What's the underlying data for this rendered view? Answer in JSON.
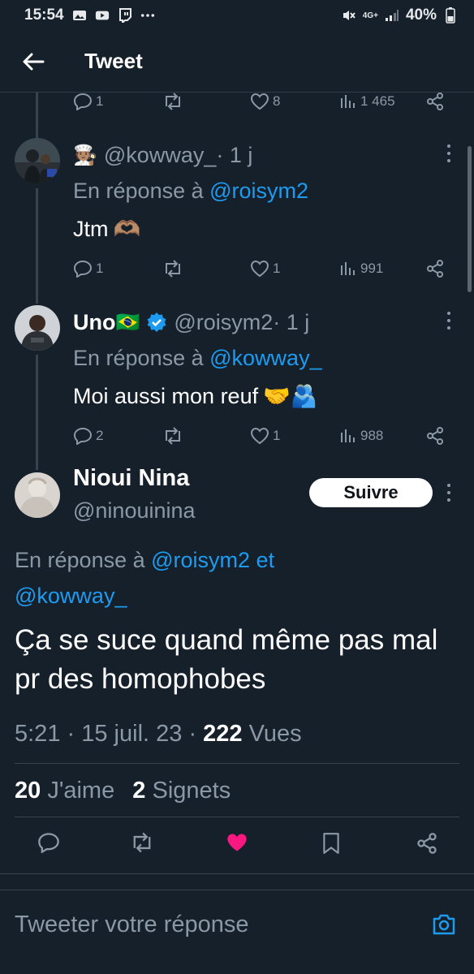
{
  "status_bar": {
    "time": "15:54",
    "battery": "40%",
    "network": "4G+"
  },
  "header": {
    "title": "Tweet"
  },
  "top_actions": {
    "replies": "1",
    "likes": "8",
    "views": "1 465"
  },
  "tweet1": {
    "handle": "@kowway_",
    "time": " · 1 j",
    "reply_prefix": "En réponse à ",
    "reply_to": "@roisym2",
    "text": "Jtm",
    "emoji": "🫶🏽",
    "actions": {
      "replies": "1",
      "likes": "1",
      "views": "991"
    }
  },
  "tweet2": {
    "name": "Uno",
    "flag": "🇧🇷",
    "handle": "@roisym2",
    "time": " · 1 j",
    "reply_prefix": "En réponse à ",
    "reply_to": "@kowway_",
    "text": "Moi aussi mon reuf",
    "emoji": "🤝🫂",
    "actions": {
      "replies": "2",
      "likes": "1",
      "views": "988"
    }
  },
  "main_tweet": {
    "name": "Nioui Nina",
    "handle": "@ninouinina",
    "follow_label": "Suivre",
    "reply_prefix": "En réponse à ",
    "reply_to_1": "@roisym2",
    "reply_and": " et",
    "reply_to_2": "@kowway_",
    "text": "Ça se suce quand même pas mal pr des homophobes",
    "time": "5:21",
    "date": "15 juil. 23",
    "views_count": "222",
    "views_label": "Vues",
    "likes_count": "20",
    "likes_label": "J'aime",
    "bookmarks_count": "2",
    "bookmarks_label": "Signets"
  },
  "compose": {
    "placeholder": "Tweeter votre réponse"
  },
  "colors": {
    "background": "#15202b",
    "accent": "#1d9bf0",
    "like": "#f91880",
    "muted": "#8b98a5"
  }
}
